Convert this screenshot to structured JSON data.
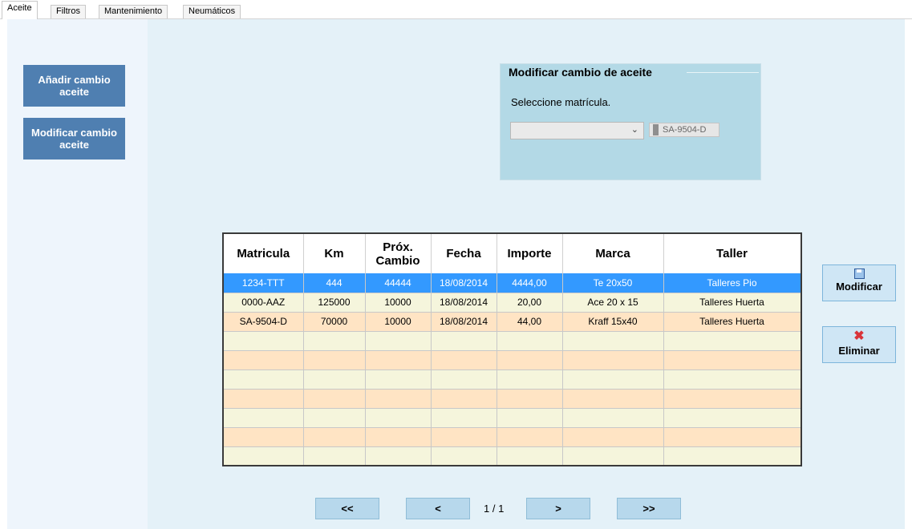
{
  "tabs": [
    {
      "label": "Aceite",
      "active": true
    },
    {
      "label": "Filtros",
      "active": false
    },
    {
      "label": "Mantenimiento",
      "active": false
    },
    {
      "label": "Neumáticos",
      "active": false
    }
  ],
  "sidebar": {
    "add_label": "Añadir cambio aceite",
    "modify_label": "Modificar cambio aceite"
  },
  "groupbox": {
    "title": "Modificar cambio de aceite",
    "prompt": "Seleccione matrícula.",
    "combo_value": "",
    "plate_value": "SA-9504-D"
  },
  "grid": {
    "columns": [
      "Matricula",
      "Km",
      "Próx. Cambio",
      "Fecha",
      "Importe",
      "Marca",
      "Taller"
    ],
    "rows": [
      [
        "1234-TTT",
        "444",
        "44444",
        "18/08/2014",
        "4444,00",
        "Te 20x50",
        "Talleres Pio"
      ],
      [
        "0000-AAZ",
        "125000",
        "10000",
        "18/08/2014",
        "20,00",
        "Ace 20 x 15",
        "Talleres Huerta"
      ],
      [
        "SA-9504-D",
        "70000",
        "10000",
        "18/08/2014",
        "44,00",
        "Kraff 15x40",
        "Talleres Huerta"
      ],
      [
        "",
        "",
        "",
        "",
        "",
        "",
        ""
      ],
      [
        "",
        "",
        "",
        "",
        "",
        "",
        ""
      ],
      [
        "",
        "",
        "",
        "",
        "",
        "",
        ""
      ],
      [
        "",
        "",
        "",
        "",
        "",
        "",
        ""
      ],
      [
        "",
        "",
        "",
        "",
        "",
        "",
        ""
      ],
      [
        "",
        "",
        "",
        "",
        "",
        "",
        ""
      ],
      [
        "",
        "",
        "",
        "",
        "",
        "",
        ""
      ]
    ],
    "selected_row": 0
  },
  "actions": {
    "modify_label": "Modificar",
    "delete_label": "Eliminar",
    "modify_icon": "save-icon",
    "delete_icon": "delete-icon"
  },
  "pager": {
    "first": "<<",
    "prev": "<",
    "page": "1 / 1",
    "next": ">",
    "last": ">>"
  },
  "colors": {
    "selected_row": "#3399ff",
    "row_odd": "#f5f5dc",
    "row_even": "#ffe4c4",
    "side_button": "#4f7fb1",
    "groupbox_bg": "#b3d9e6"
  }
}
